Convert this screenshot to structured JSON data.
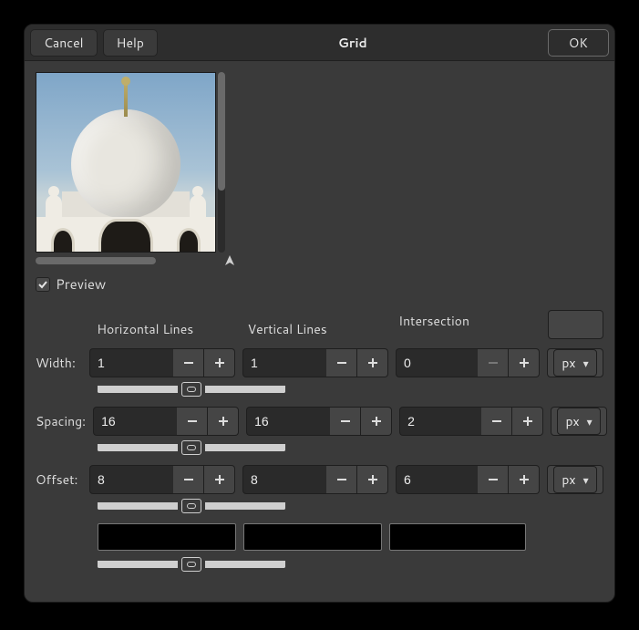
{
  "titlebar": {
    "cancel": "Cancel",
    "help": "Help",
    "title": "Grid",
    "ok": "OK"
  },
  "preview": {
    "checkbox_checked": true,
    "label": "Preview"
  },
  "columns": {
    "horizontal": "Horizontal Lines",
    "vertical": "Vertical Lines",
    "intersection": "Intersection"
  },
  "rows": {
    "width": {
      "label": "Width:",
      "h": "1",
      "v": "1",
      "i": "0",
      "unit": "px",
      "i_minus_disabled": true
    },
    "spacing": {
      "label": "Spacing:",
      "h": "16",
      "v": "16",
      "i": "2",
      "unit": "px"
    },
    "offset": {
      "label": "Offset:",
      "h": "8",
      "v": "8",
      "i": "6",
      "unit": "px"
    }
  },
  "colors": {
    "h": "#000000",
    "v": "#000000",
    "i": "#000000"
  }
}
